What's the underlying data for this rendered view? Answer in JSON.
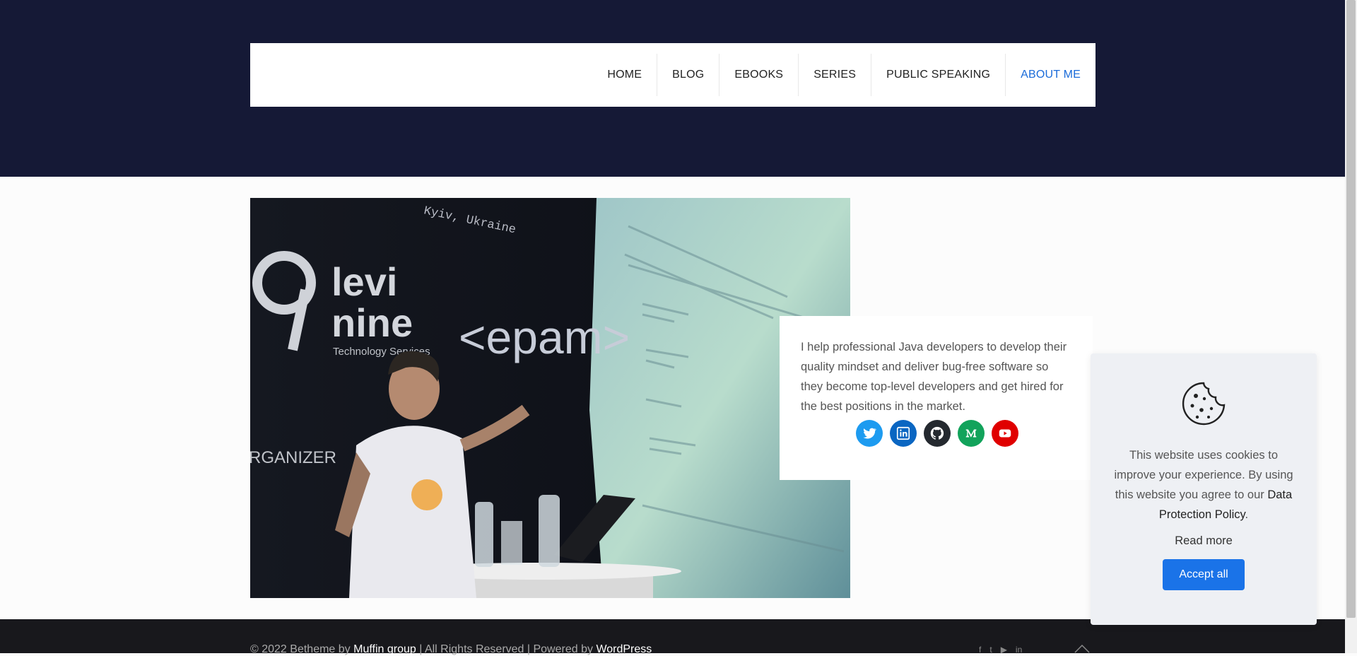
{
  "nav": {
    "items": [
      {
        "label": "HOME"
      },
      {
        "label": "BLOG"
      },
      {
        "label": "EBOOKS"
      },
      {
        "label": "SERIES"
      },
      {
        "label": "PUBLIC SPEAKING"
      },
      {
        "label": "ABOUT ME",
        "active": true
      }
    ]
  },
  "photo": {
    "slide_header": "Kyiv, Ukraine",
    "brand_1": "levi",
    "brand_2": "nine",
    "brand_sub": "Technology Services",
    "brand_3": "<epam>",
    "side_text": "RGANIZER"
  },
  "intro": {
    "text": "I help professional Java developers to develop their quality mindset and deliver bug-free software so they become top-level developers and get hired for the best positions in the market."
  },
  "social": [
    {
      "icon": "twitter-icon",
      "color": "#1d9bf0"
    },
    {
      "icon": "linkedin-icon",
      "color": "#0a66c2"
    },
    {
      "icon": "github-icon",
      "color": "#24292f"
    },
    {
      "icon": "medium-icon",
      "color": "#12a35b"
    },
    {
      "icon": "youtube-icon",
      "color": "#e00000"
    }
  ],
  "cookie": {
    "message": "This website uses cookies to improve your experience. By using this website you agree to our",
    "policy_link": "Data Protection Policy",
    "period": ".",
    "read_more": "Read more",
    "accept": "Accept all"
  },
  "footer": {
    "prefix": "© 2022 Betheme by",
    "muffin": "Muffin group",
    "middle": "| All Rights Reserved | Powered by",
    "wordpress": "WordPress"
  },
  "colors": {
    "hero": "#151936",
    "accent": "#1a6bd9",
    "accept_button": "#1a73e8"
  }
}
